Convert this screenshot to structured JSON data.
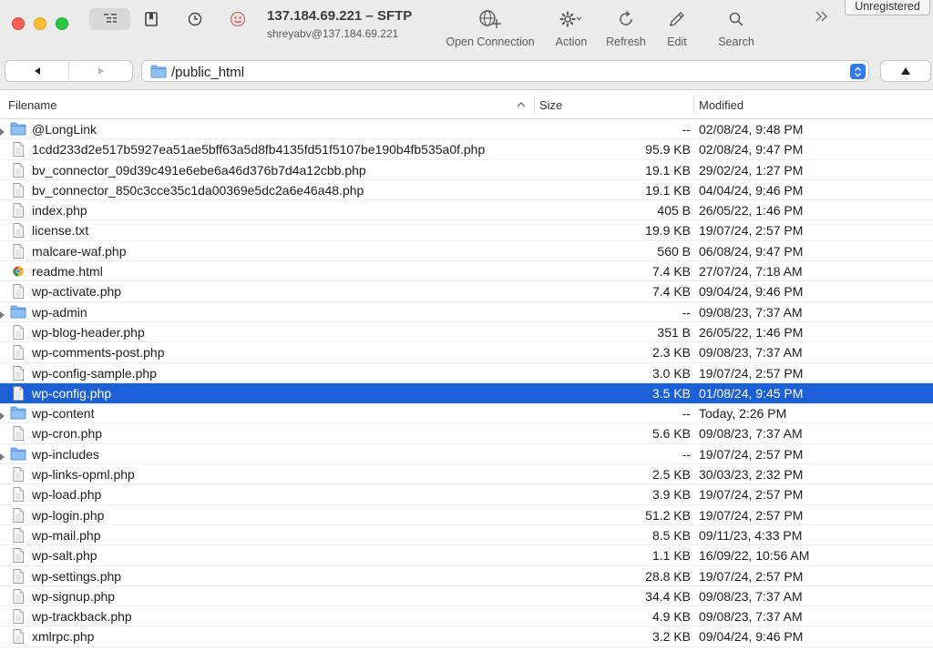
{
  "window": {
    "title": "137.184.69.221 – SFTP",
    "subtitle": "shreyabv@137.184.69.221",
    "unregistered_label": "Unregistered"
  },
  "toolbar": {
    "open_connection": "Open Connection",
    "action": "Action",
    "refresh": "Refresh",
    "edit": "Edit",
    "search": "Search"
  },
  "pathbar": {
    "path": "/public_html"
  },
  "columns": {
    "filename": "Filename",
    "size": "Size",
    "modified": "Modified"
  },
  "files": [
    {
      "name": "@LongLink",
      "size": "--",
      "modified": "02/08/24, 9:48 PM",
      "kind": "folder",
      "selected": false
    },
    {
      "name": "1cdd233d2e517b5927ea51ae5bff63a5d8fb4135fd51f5107be190b4fb535a0f.php",
      "size": "95.9 KB",
      "modified": "02/08/24, 9:47 PM",
      "kind": "file",
      "selected": false
    },
    {
      "name": "bv_connector_09d39c491e6ebe6a46d376b7d4a12cbb.php",
      "size": "19.1 KB",
      "modified": "29/02/24, 1:27 PM",
      "kind": "file",
      "selected": false
    },
    {
      "name": "bv_connector_850c3cce35c1da00369e5dc2a6e46a48.php",
      "size": "19.1 KB",
      "modified": "04/04/24, 9:46 PM",
      "kind": "file",
      "selected": false
    },
    {
      "name": "index.php",
      "size": "405 B",
      "modified": "26/05/22, 1:46 PM",
      "kind": "file",
      "selected": false
    },
    {
      "name": "license.txt",
      "size": "19.9 KB",
      "modified": "19/07/24, 2:57 PM",
      "kind": "file",
      "selected": false
    },
    {
      "name": "malcare-waf.php",
      "size": "560 B",
      "modified": "06/08/24, 9:47 PM",
      "kind": "file",
      "selected": false
    },
    {
      "name": "readme.html",
      "size": "7.4 KB",
      "modified": "27/07/24, 7:18 AM",
      "kind": "html",
      "selected": false
    },
    {
      "name": "wp-activate.php",
      "size": "7.4 KB",
      "modified": "09/04/24, 9:46 PM",
      "kind": "file",
      "selected": false
    },
    {
      "name": "wp-admin",
      "size": "--",
      "modified": "09/08/23, 7:37 AM",
      "kind": "folder",
      "selected": false
    },
    {
      "name": "wp-blog-header.php",
      "size": "351 B",
      "modified": "26/05/22, 1:46 PM",
      "kind": "file",
      "selected": false
    },
    {
      "name": "wp-comments-post.php",
      "size": "2.3 KB",
      "modified": "09/08/23, 7:37 AM",
      "kind": "file",
      "selected": false
    },
    {
      "name": "wp-config-sample.php",
      "size": "3.0 KB",
      "modified": "19/07/24, 2:57 PM",
      "kind": "file",
      "selected": false
    },
    {
      "name": "wp-config.php",
      "size": "3.5 KB",
      "modified": "01/08/24, 9:45 PM",
      "kind": "file",
      "selected": true
    },
    {
      "name": "wp-content",
      "size": "--",
      "modified": "Today, 2:26 PM",
      "kind": "folder",
      "selected": false
    },
    {
      "name": "wp-cron.php",
      "size": "5.6 KB",
      "modified": "09/08/23, 7:37 AM",
      "kind": "file",
      "selected": false
    },
    {
      "name": "wp-includes",
      "size": "--",
      "modified": "19/07/24, 2:57 PM",
      "kind": "folder",
      "selected": false
    },
    {
      "name": "wp-links-opml.php",
      "size": "2.5 KB",
      "modified": "30/03/23, 2:32 PM",
      "kind": "file",
      "selected": false
    },
    {
      "name": "wp-load.php",
      "size": "3.9 KB",
      "modified": "19/07/24, 2:57 PM",
      "kind": "file",
      "selected": false
    },
    {
      "name": "wp-login.php",
      "size": "51.2 KB",
      "modified": "19/07/24, 2:57 PM",
      "kind": "file",
      "selected": false
    },
    {
      "name": "wp-mail.php",
      "size": "8.5 KB",
      "modified": "09/11/23, 4:33 PM",
      "kind": "file",
      "selected": false
    },
    {
      "name": "wp-salt.php",
      "size": "1.1 KB",
      "modified": "16/09/22, 10:56 AM",
      "kind": "file",
      "selected": false
    },
    {
      "name": "wp-settings.php",
      "size": "28.8 KB",
      "modified": "19/07/24, 2:57 PM",
      "kind": "file",
      "selected": false
    },
    {
      "name": "wp-signup.php",
      "size": "34.4 KB",
      "modified": "09/08/23, 7:37 AM",
      "kind": "file",
      "selected": false
    },
    {
      "name": "wp-trackback.php",
      "size": "4.9 KB",
      "modified": "09/08/23, 7:37 AM",
      "kind": "file",
      "selected": false
    },
    {
      "name": "xmlrpc.php",
      "size": "3.2 KB",
      "modified": "09/04/24, 9:46 PM",
      "kind": "file",
      "selected": false
    }
  ],
  "colors": {
    "selection": "#1d5fd6",
    "folder": "#6fa8e8",
    "accent": "#2f7bf6"
  }
}
